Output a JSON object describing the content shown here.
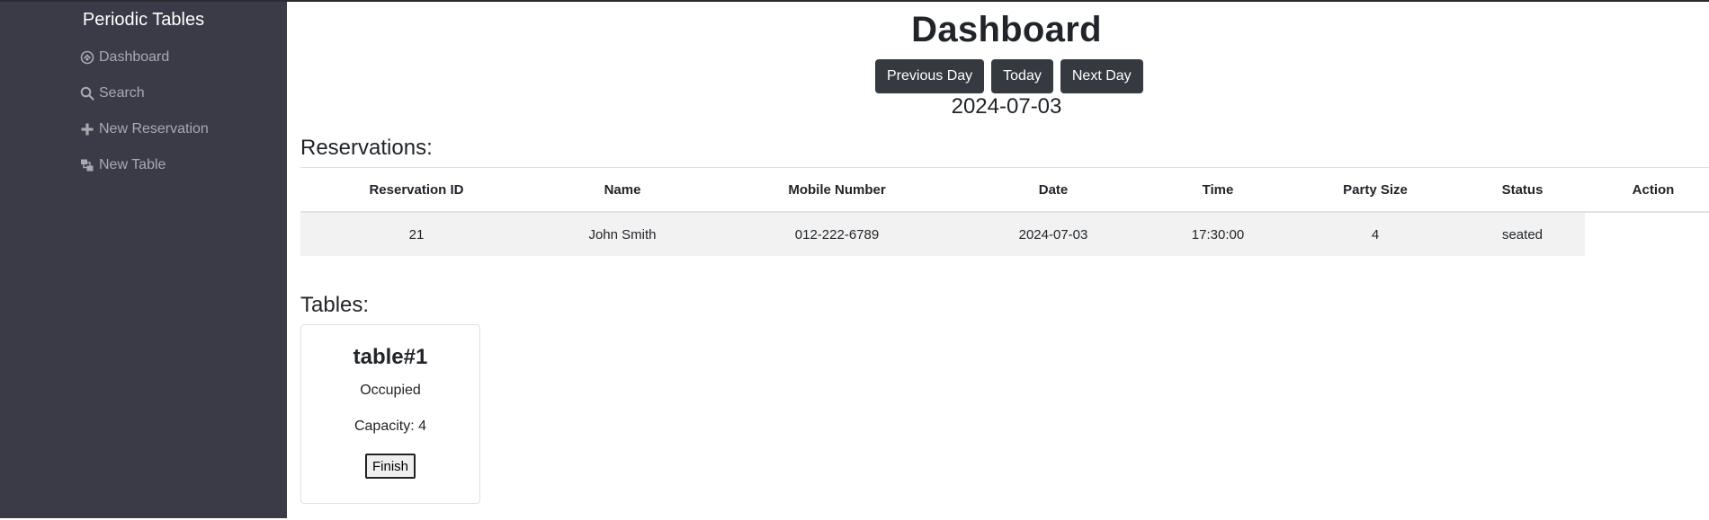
{
  "app": {
    "title": "Periodic Tables"
  },
  "sidebar": {
    "items": [
      {
        "label": "Dashboard",
        "icon": "dashboard-icon"
      },
      {
        "label": "Search",
        "icon": "search-icon"
      },
      {
        "label": "New Reservation",
        "icon": "plus-icon"
      },
      {
        "label": "New Table",
        "icon": "new-table-icon"
      }
    ]
  },
  "header": {
    "title": "Dashboard",
    "buttons": {
      "previous": "Previous Day",
      "today": "Today",
      "next": "Next Day"
    },
    "date": "2024-07-03"
  },
  "reservations": {
    "heading": "Reservations:",
    "columns": [
      "Reservation ID",
      "Name",
      "Mobile Number",
      "Date",
      "Time",
      "Party Size",
      "Status",
      "Action"
    ],
    "rows": [
      {
        "id": "21",
        "name": "John Smith",
        "mobile": "012-222-6789",
        "date": "2024-07-03",
        "time": "17:30:00",
        "party_size": "4",
        "status": "seated"
      }
    ]
  },
  "tables": {
    "heading": "Tables:",
    "cards": [
      {
        "name": "table#1",
        "status": "Occupied",
        "capacity": "Capacity: 4",
        "button": "Finish"
      }
    ]
  },
  "colors": {
    "sidebar_bg": "#3a3b46",
    "button_dark": "#343a40",
    "row_stripe": "#f2f2f2"
  }
}
